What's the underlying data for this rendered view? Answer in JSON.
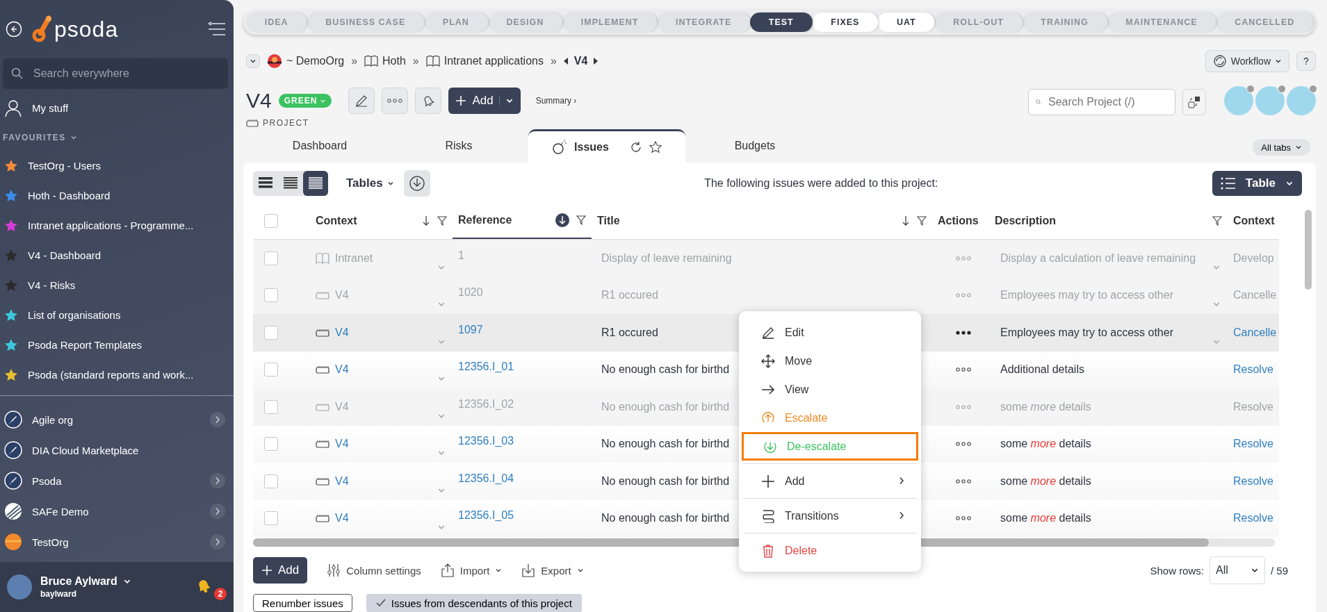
{
  "stages": [
    {
      "label": "IDEA",
      "kind": "other"
    },
    {
      "label": "BUSINESS CASE",
      "kind": "other"
    },
    {
      "label": "PLAN",
      "kind": "other"
    },
    {
      "label": "DESIGN",
      "kind": "other"
    },
    {
      "label": "IMPLEMENT",
      "kind": "other"
    },
    {
      "label": "INTEGRATE",
      "kind": "other"
    },
    {
      "label": "TEST",
      "kind": "current"
    },
    {
      "label": "FIXES",
      "kind": "available"
    },
    {
      "label": "UAT",
      "kind": "available"
    },
    {
      "label": "ROLL-OUT",
      "kind": "other"
    },
    {
      "label": "TRAINING",
      "kind": "other"
    },
    {
      "label": "MAINTENANCE",
      "kind": "other"
    },
    {
      "label": "CANCELLED",
      "kind": "other"
    }
  ],
  "sidebar": {
    "logo": "psoda",
    "search": {
      "placeholder": "Search everywhere"
    },
    "my_stuff": "My stuff",
    "favourites": {
      "title": "FAVOURITES",
      "expanded": true,
      "items": [
        {
          "label": "TestOrg - Users",
          "color": "#f28a3c"
        },
        {
          "label": "Hoth - Dashboard",
          "color": "#3b8ee8"
        },
        {
          "label": "Intranet applications - Programme...",
          "color": "#d63ed8"
        },
        {
          "label": "V4 - Dashboard",
          "color": "#2b2b2b"
        },
        {
          "label": "V4 - Risks",
          "color": "#2b2b2b"
        },
        {
          "label": "List of organisations",
          "color": "#3cc8dc"
        },
        {
          "label": "Psoda Report Templates",
          "color": "#3cc8dc"
        },
        {
          "label": "Psoda (standard reports and work...",
          "color": "#e8c030"
        }
      ]
    },
    "organisations": [
      {
        "label": "Agile org",
        "kind": "rocket",
        "has_children": true
      },
      {
        "label": "DIA Cloud Marketplace",
        "kind": "rocket",
        "has_children": false
      },
      {
        "label": "Psoda",
        "kind": "rocket",
        "has_children": true
      },
      {
        "label": "SAFe Demo",
        "kind": "stripes",
        "has_children": true
      },
      {
        "label": "TestOrg",
        "kind": "sun",
        "has_children": true
      }
    ],
    "user": {
      "name": "Bruce Aylward",
      "username": "baylward",
      "notifications": "2"
    }
  },
  "breadcrumb": [
    {
      "label": "~ DemoOrg",
      "kind": "org",
      "separator": "»"
    },
    {
      "label": "Hoth",
      "kind": "program",
      "separator": "»"
    },
    {
      "label": "Intranet applications",
      "kind": "program",
      "separator": "»"
    },
    {
      "label": "V4",
      "kind": "current"
    }
  ],
  "header": {
    "workflow": "Workflow",
    "help": "?",
    "title": "V4",
    "status": "GREEN",
    "type": "PROJECT",
    "add": "Add",
    "summary": "Summary ›",
    "search": {
      "placeholder": "Search Project (/)"
    }
  },
  "tabs": [
    {
      "label": "Dashboard",
      "selected": false
    },
    {
      "label": "Risks",
      "selected": false
    },
    {
      "label": "Issues",
      "selected": true
    },
    {
      "label": "Budgets",
      "selected": false
    }
  ],
  "all_tabs": "All tabs",
  "issues": {
    "view_modes": [
      {
        "selected": false
      },
      {
        "selected": false
      },
      {
        "selected": true
      }
    ],
    "tables": "Tables",
    "intro": "The following issues were added to this project:",
    "display": "Table",
    "select_all": {
      "checked": false
    },
    "columns": [
      {
        "label": "Context",
        "sortable": true,
        "sorted": false,
        "filter": true
      },
      {
        "label": "Reference",
        "sortable": true,
        "sorted": true,
        "filter": true
      },
      {
        "label": "Title",
        "sortable": true,
        "sorted": false,
        "filter": true
      },
      {
        "label": "Actions",
        "sortable": false,
        "sorted": false,
        "filter": false
      },
      {
        "label": "Description",
        "sortable": false,
        "sorted": false,
        "filter": true
      },
      {
        "label": "Context"
      }
    ],
    "rows": [
      {
        "kind": "program",
        "context": "Intranet",
        "reference": "1",
        "title": "Display of leave remaining",
        "description": "Display a calculation of leave remaining",
        "expandable": true,
        "status": "Develop",
        "disabled": true,
        "selected": false,
        "checked": false
      },
      {
        "kind": "project",
        "context": "V4",
        "reference": "1020",
        "title": "R1 occured",
        "description": "Employees may try to access other",
        "expandable": true,
        "status": "Cancelle",
        "disabled": true,
        "selected": false,
        "checked": false
      },
      {
        "kind": "project",
        "context": "V4",
        "reference": "1097",
        "title": "R1 occured",
        "description": "Employees may try to access other",
        "expandable": true,
        "status": "Cancelle",
        "disabled": false,
        "selected": true,
        "checked": false
      },
      {
        "kind": "project",
        "context": "V4",
        "reference": "12356.I_01",
        "title": "No enough cash for birthd",
        "description": "Additional details",
        "expandable": false,
        "status": "Resolve",
        "disabled": false,
        "selected": false,
        "checked": false
      },
      {
        "kind": "project",
        "context": "V4",
        "reference": "12356.I_02",
        "title": "No enough cash for birthd",
        "description": "some *more* details",
        "expandable": false,
        "status": "Resolve",
        "disabled": true,
        "selected": false,
        "checked": false
      },
      {
        "kind": "project",
        "context": "V4",
        "reference": "12356.I_03",
        "title": "No enough cash for birthd",
        "description": "some *more* details",
        "expandable": false,
        "status": "Resolve",
        "disabled": false,
        "selected": false,
        "checked": false
      },
      {
        "kind": "project",
        "context": "V4",
        "reference": "12356.I_04",
        "title": "No enough cash for birthd",
        "description": "some *more* details",
        "expandable": false,
        "status": "Resolve",
        "disabled": false,
        "selected": false,
        "checked": false
      },
      {
        "kind": "project",
        "context": "V4",
        "reference": "12356.I_05",
        "title": "No enough cash for birthd",
        "description": "some *more* details",
        "expandable": false,
        "status": "Resolve",
        "disabled": false,
        "selected": false,
        "checked": false
      }
    ],
    "footer": {
      "add": "Add",
      "column_settings": "Column settings",
      "import": "Import",
      "export": "Export",
      "show_rows_label": "Show rows:",
      "show_rows": "All",
      "total": "/ 59",
      "renumber": "Renumber issues",
      "descendants": {
        "label": "Issues from descendants of this project",
        "checked": true
      }
    }
  },
  "context_menu": {
    "items": [
      {
        "label": "Edit",
        "kind": "edit",
        "selected": false,
        "has_submenu": false
      },
      {
        "label": "Move",
        "kind": "move",
        "selected": false,
        "has_submenu": false
      },
      {
        "label": "View",
        "kind": "view",
        "selected": false,
        "has_submenu": false
      },
      {
        "label": "Escalate",
        "kind": "escalate",
        "selected": false,
        "has_submenu": false
      },
      {
        "label": "De-escalate",
        "kind": "deescalate",
        "selected": true,
        "has_submenu": false
      },
      {
        "label": "Add",
        "kind": "add",
        "selected": false,
        "has_submenu": true
      },
      {
        "label": "Transitions",
        "kind": "transitions",
        "selected": false,
        "has_submenu": true
      },
      {
        "label": "Delete",
        "kind": "delete",
        "selected": false,
        "has_submenu": false
      }
    ]
  }
}
